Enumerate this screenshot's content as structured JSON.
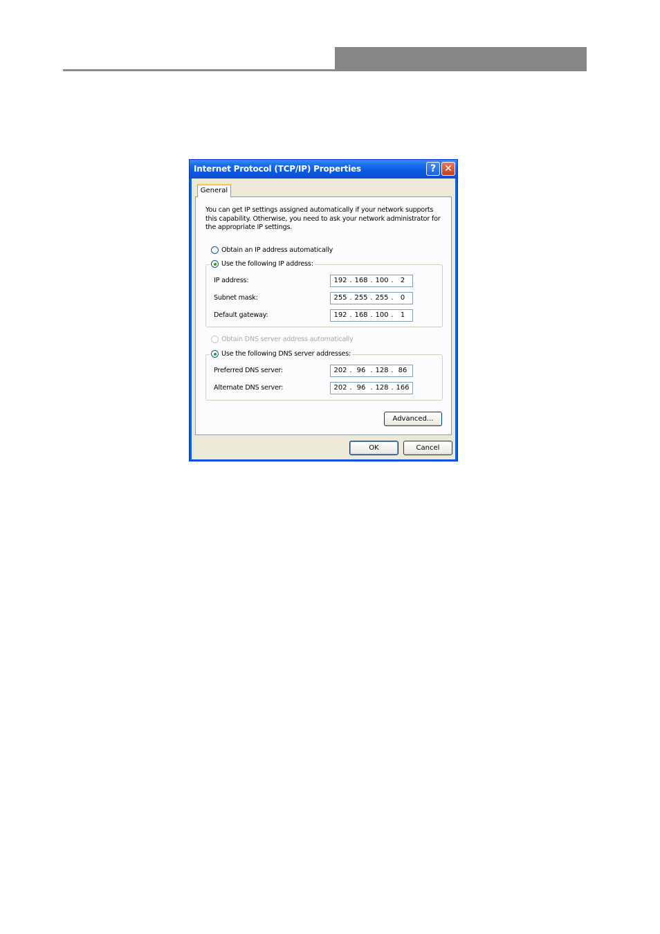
{
  "window": {
    "title": "Internet Protocol (TCP/IP) Properties",
    "help_glyph": "?",
    "close_glyph": "✕"
  },
  "tabs": [
    {
      "label": "General",
      "selected": true
    }
  ],
  "description": "You can get IP settings assigned automatically if your network supports this capability. Otherwise, you need to ask your network administrator for the appropriate IP settings.",
  "ip_mode": {
    "auto_label": "Obtain an IP address automatically",
    "manual_label": "Use the following IP address:",
    "selected": "manual"
  },
  "ip_fields": [
    {
      "label": "IP address:",
      "octets": [
        "192",
        "168",
        "100",
        "2"
      ]
    },
    {
      "label": "Subnet mask:",
      "octets": [
        "255",
        "255",
        "255",
        "0"
      ]
    },
    {
      "label": "Default gateway:",
      "octets": [
        "192",
        "168",
        "100",
        "1"
      ]
    }
  ],
  "dns_mode": {
    "auto_label": "Obtain DNS server address automatically",
    "manual_label": "Use the following DNS server addresses:",
    "selected": "manual",
    "auto_disabled": true
  },
  "dns_fields": [
    {
      "label": "Preferred DNS server:",
      "octets": [
        "202",
        "96",
        "128",
        "86"
      ]
    },
    {
      "label": "Alternate DNS server:",
      "octets": [
        "202",
        "96",
        "128",
        "166"
      ]
    }
  ],
  "buttons": {
    "advanced": "Advanced...",
    "ok": "OK",
    "cancel": "Cancel"
  }
}
